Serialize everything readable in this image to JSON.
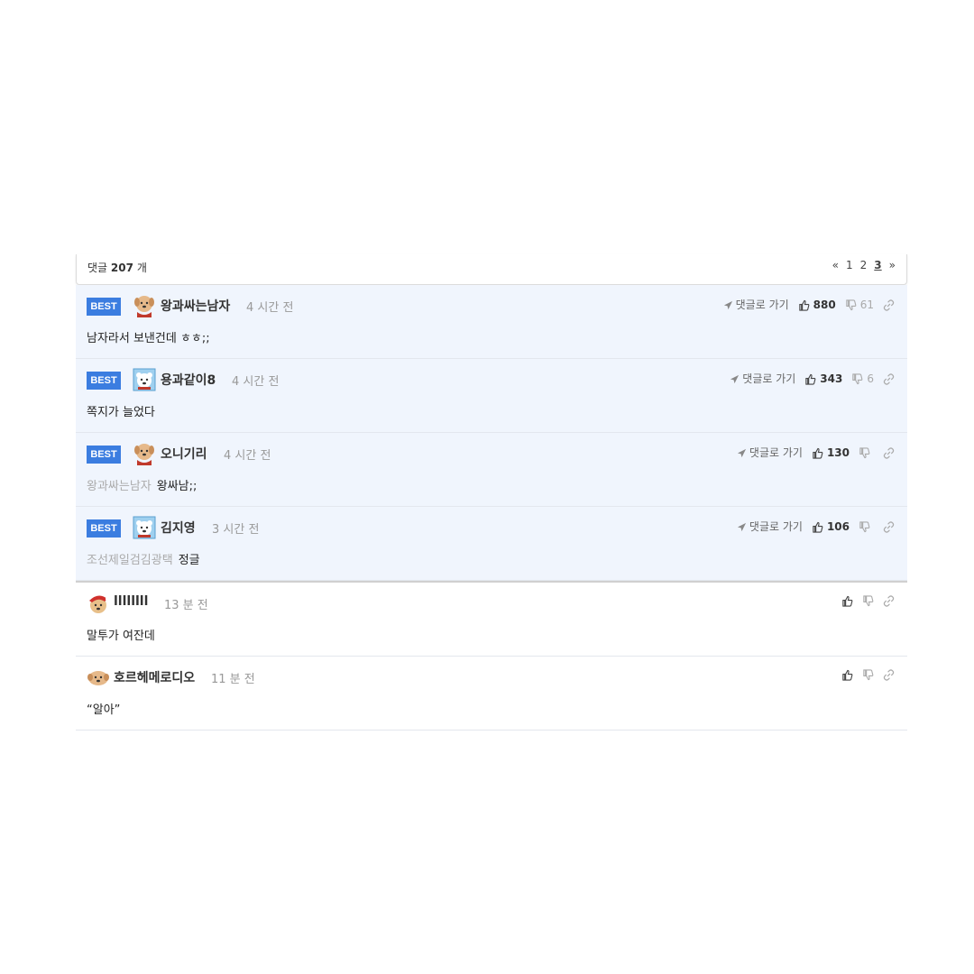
{
  "header": {
    "count_prefix": "댓글",
    "count_value": "207",
    "count_suffix": "개",
    "pager": {
      "prev": "«",
      "pages": [
        "1",
        "2",
        "3"
      ],
      "current": "3",
      "next": "»"
    }
  },
  "goto_label": "댓글로 가기",
  "best_label": "BEST",
  "best_comments": [
    {
      "author": "왕과싸는남자",
      "time": "4 시간 전",
      "reply_to": "",
      "text": "남자라서 보낸건데 ㅎㅎ;;",
      "likes": "880",
      "dislikes": "61",
      "avatar": "puppy-avatar"
    },
    {
      "author": "용과같이8",
      "time": "4 시간 전",
      "reply_to": "",
      "text": "쪽지가 늘었다",
      "likes": "343",
      "dislikes": "6",
      "avatar": "polar-bear-avatar"
    },
    {
      "author": "오니기리",
      "time": "4 시간 전",
      "reply_to": "왕과싸는남자",
      "text": "왕싸남;;",
      "likes": "130",
      "dislikes": "",
      "avatar": "puppy-avatar"
    },
    {
      "author": "김지영",
      "time": "3 시간 전",
      "reply_to": "조선제일검김광택",
      "text": "정글",
      "likes": "106",
      "dislikes": "",
      "avatar": "polar-bear-avatar"
    }
  ],
  "comments": [
    {
      "author": "llllllll",
      "time": "13 분 전",
      "text": "말투가 여잔데",
      "avatar": "santa-puppy-avatar"
    },
    {
      "author": "호르헤메로디오",
      "time": "11 분 전",
      "text": "“알아”",
      "avatar": "puppy-face-avatar"
    }
  ],
  "colors": {
    "best_bg": "#f0f5fd",
    "badge": "#3b7de0",
    "time": "#999999"
  }
}
